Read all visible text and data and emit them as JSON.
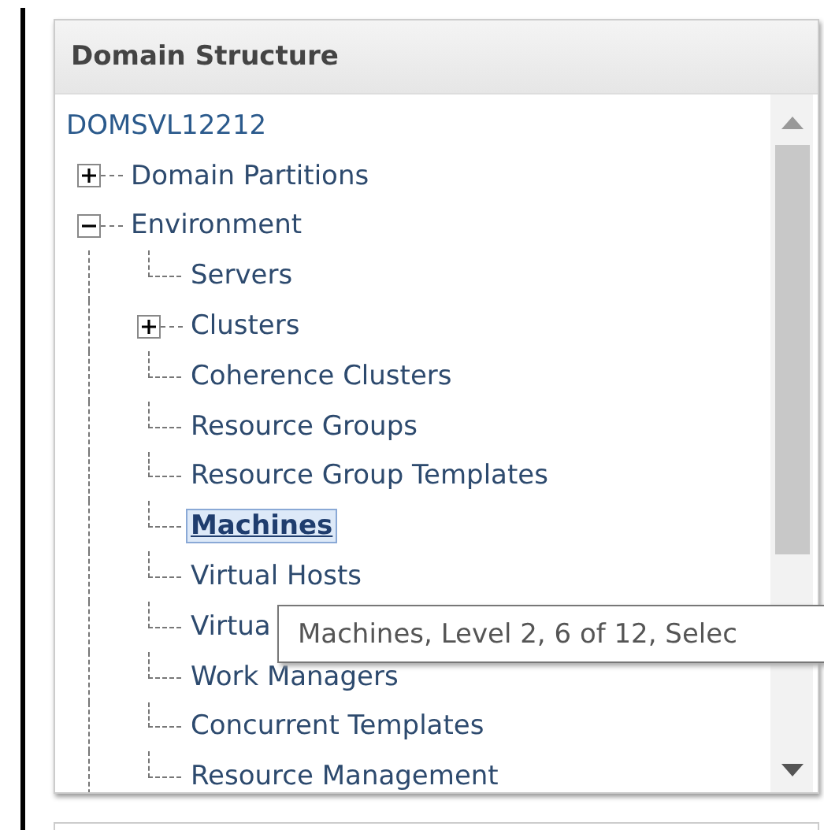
{
  "panel": {
    "title": "Domain Structure"
  },
  "tree": {
    "root": "DOMSVL12212",
    "children": [
      {
        "label": "Domain Partitions",
        "kind": "folder",
        "expanded": false,
        "selected": false
      },
      {
        "label": "Environment",
        "kind": "folder",
        "expanded": true,
        "selected": false,
        "children": [
          {
            "label": "Servers",
            "kind": "leaf",
            "selected": false
          },
          {
            "label": "Clusters",
            "kind": "folder",
            "expanded": false,
            "selected": false
          },
          {
            "label": "Coherence Clusters",
            "kind": "leaf",
            "selected": false
          },
          {
            "label": "Resource Groups",
            "kind": "leaf",
            "selected": false
          },
          {
            "label": "Resource Group Templates",
            "kind": "leaf",
            "selected": false
          },
          {
            "label": "Machines",
            "kind": "leaf",
            "selected": true
          },
          {
            "label": "Virtual Hosts",
            "kind": "leaf",
            "selected": false
          },
          {
            "label": "Virtua",
            "kind": "leaf",
            "selected": false
          },
          {
            "label": "Work Managers",
            "kind": "leaf",
            "selected": false
          },
          {
            "label": "Concurrent Templates",
            "kind": "leaf",
            "selected": false
          },
          {
            "label": "Resource Management",
            "kind": "leaf",
            "selected": false
          }
        ]
      }
    ]
  },
  "tooltip": "Machines, Level 2, 6 of 12, Selec"
}
